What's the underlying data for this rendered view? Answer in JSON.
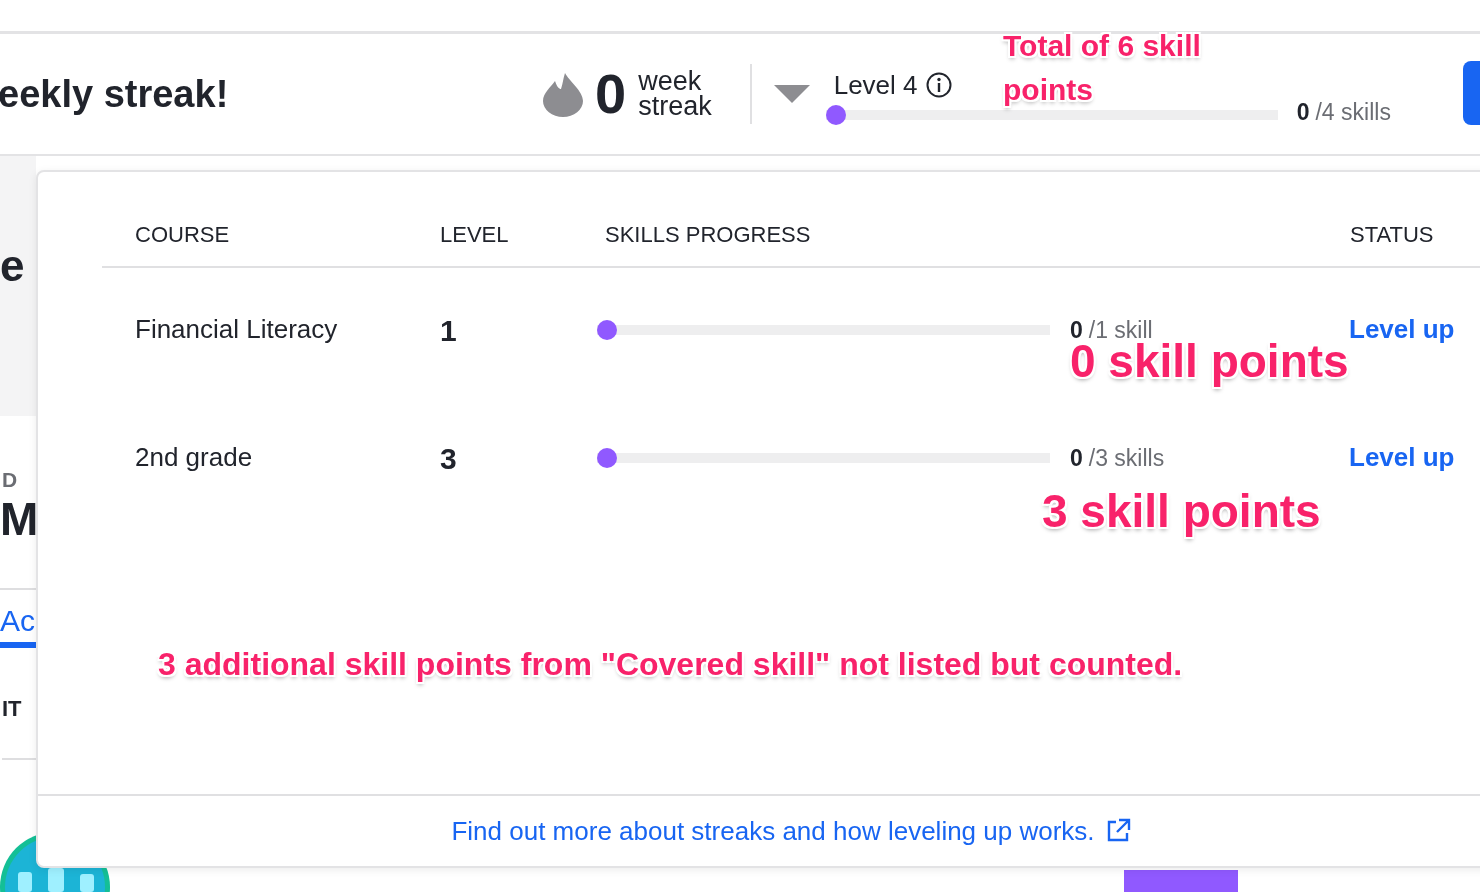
{
  "header": {
    "title": "eekly streak!",
    "streak": {
      "count": "0",
      "label_1": "week",
      "label_2": "streak"
    },
    "level": {
      "label": "Level 4",
      "level": 0,
      "count": "0",
      "total": "/4 skills"
    }
  },
  "background": {
    "heading_fragment": "e",
    "overline": "D",
    "title_fragment": "M",
    "tab": "Ac",
    "tab_selected": true,
    "column": "IT"
  },
  "popup": {
    "columns": [
      "COURSE",
      "LEVEL",
      "SKILLS PROGRESS",
      "STATUS"
    ],
    "rows": [
      {
        "course": "Financial Literacy",
        "level_number": "1",
        "level": 0,
        "count": "0",
        "total": "/1 skill",
        "status": "Level up"
      },
      {
        "course": "2nd grade",
        "level_number": "3",
        "level": 0,
        "count": "0",
        "total": "/3 skills",
        "status": "Level up"
      }
    ],
    "footer_link": "Find out more about streaks and how leveling up works."
  },
  "annotations": [
    {
      "text": "Total of 6 skill points"
    },
    {
      "text": "0 skill points"
    },
    {
      "text": "3 skill points"
    },
    {
      "text": "3 additional skill points from \"Covered skill\" not listed but counted."
    }
  ]
}
